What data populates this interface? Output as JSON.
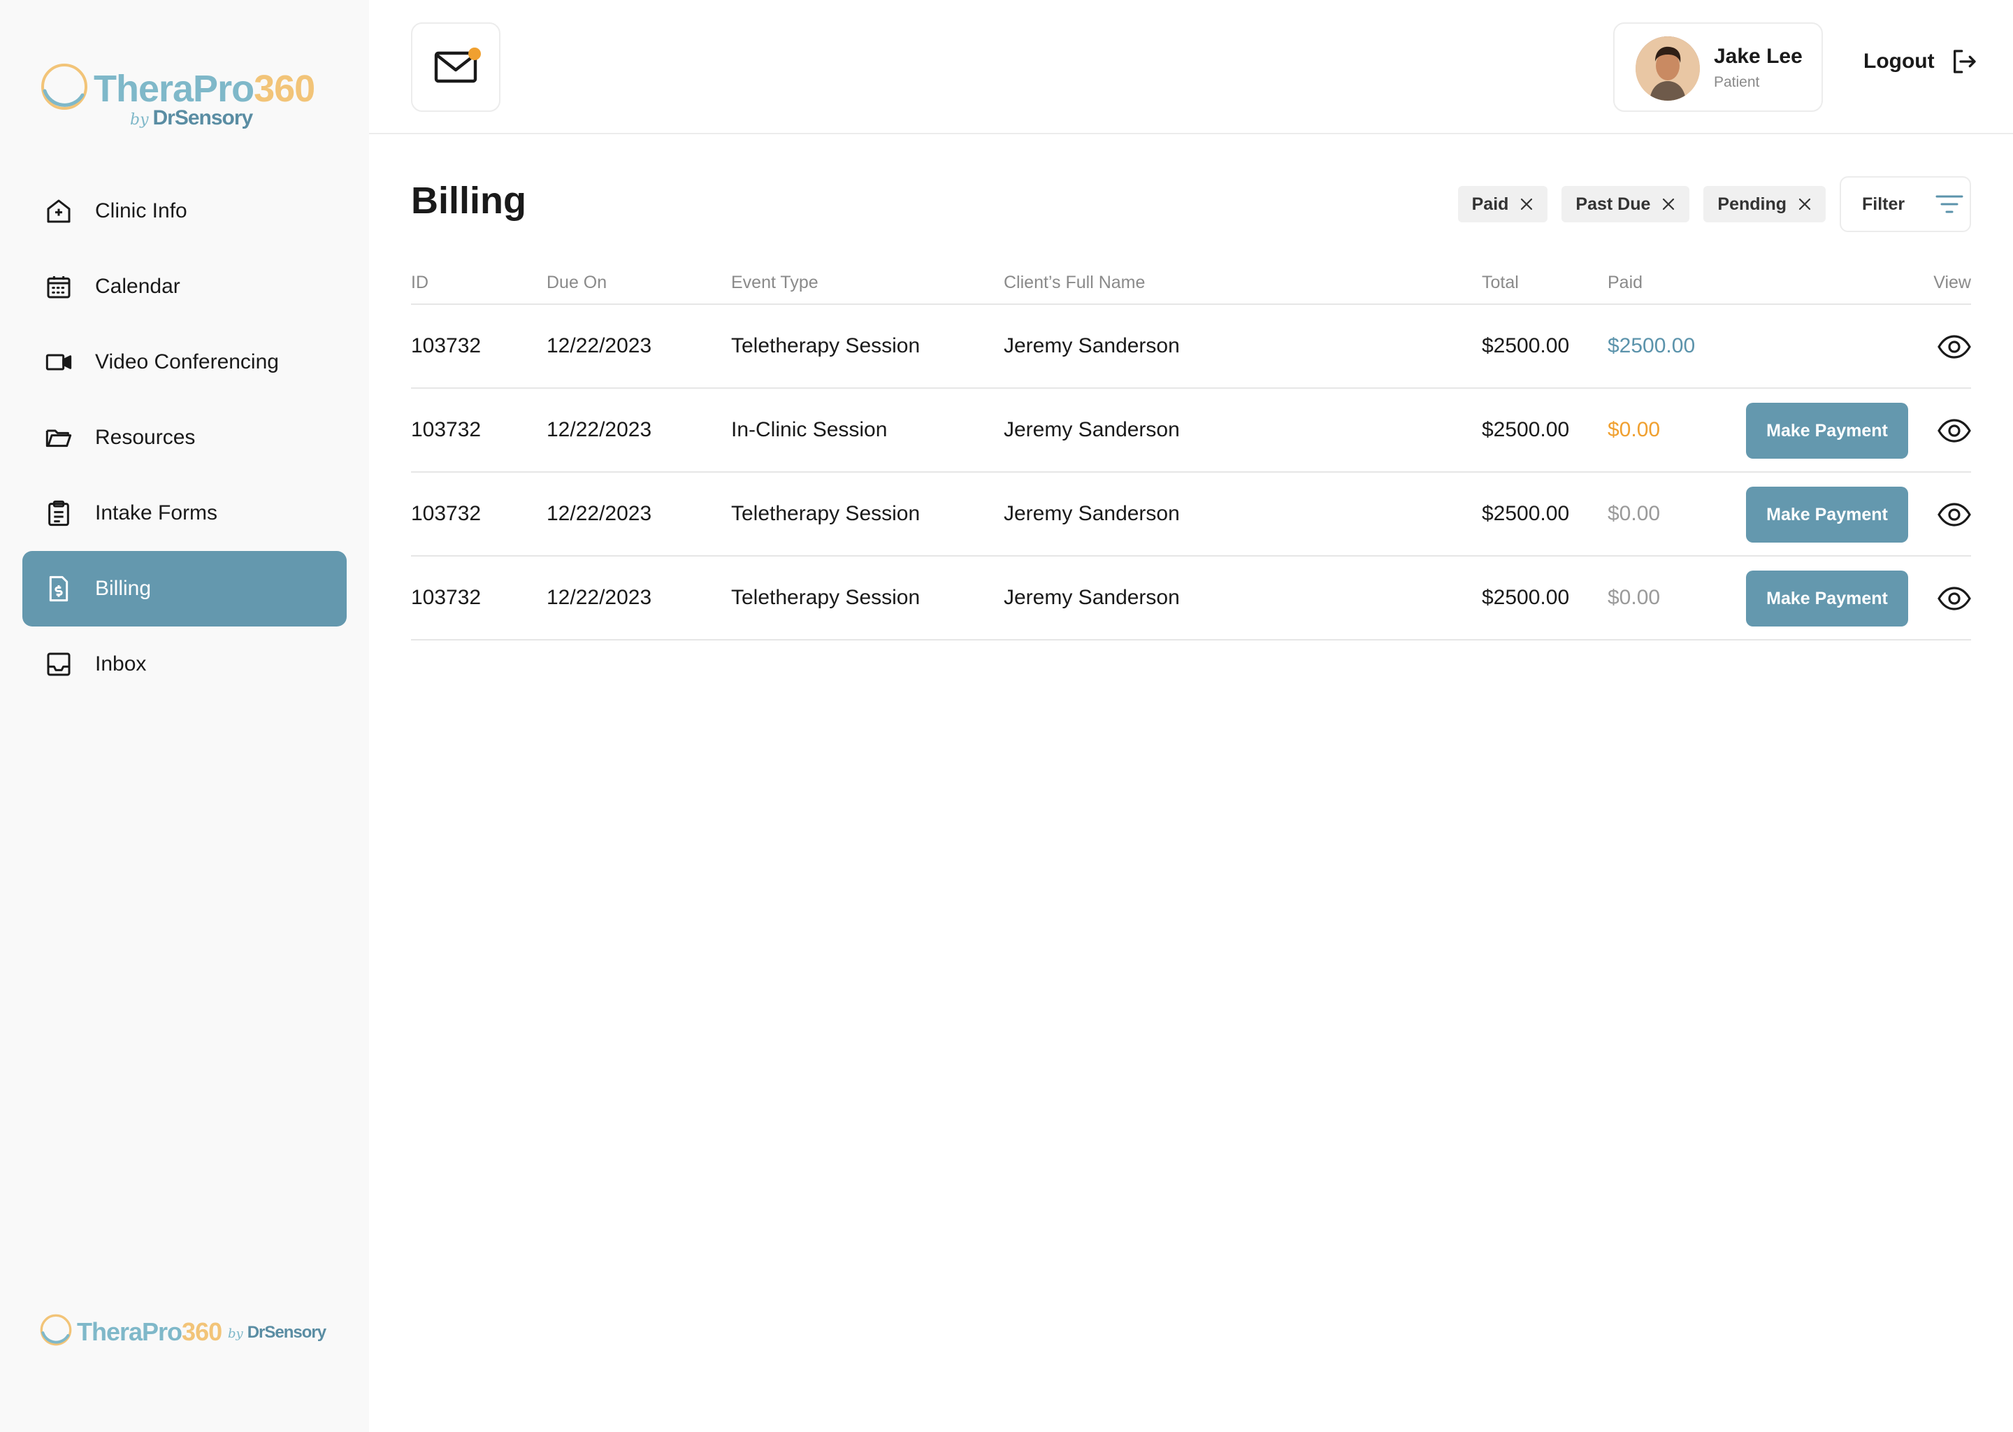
{
  "brand": {
    "name_part1": "TheraPro",
    "name_part2": "360",
    "by": "by",
    "sub": "DrSensory",
    "colors": {
      "teal": "#7fb8c9",
      "gold": "#f2c478",
      "accent": "#6498ae"
    }
  },
  "sidebar": {
    "items": [
      {
        "label": "Clinic Info",
        "icon": "clinic-icon",
        "active": false
      },
      {
        "label": "Calendar",
        "icon": "calendar-icon",
        "active": false
      },
      {
        "label": "Video Conferencing",
        "icon": "video-icon",
        "active": false
      },
      {
        "label": "Resources",
        "icon": "folder-icon",
        "active": false
      },
      {
        "label": "Intake Forms",
        "icon": "clipboard-icon",
        "active": false
      },
      {
        "label": "Billing",
        "icon": "invoice-icon",
        "active": true
      },
      {
        "label": "Inbox",
        "icon": "inbox-icon",
        "active": false
      }
    ]
  },
  "header": {
    "mail_icon": "mail-icon",
    "has_unread": true,
    "user": {
      "name": "Jake Lee",
      "role": "Patient"
    },
    "logout_label": "Logout"
  },
  "page": {
    "title": "Billing",
    "chips": [
      {
        "label": "Paid"
      },
      {
        "label": "Past Due"
      },
      {
        "label": "Pending"
      }
    ],
    "filter_label": "Filter"
  },
  "table": {
    "columns": [
      "ID",
      "Due On",
      "Event Type",
      "Client’s Full Name",
      "Total",
      "Paid",
      "View"
    ],
    "rows": [
      {
        "id": "103732",
        "due_on": "12/22/2023",
        "event_type": "Teletherapy Session",
        "client": "Jeremy Sanderson",
        "total": "$2500.00",
        "paid": "$2500.00",
        "paid_status": "paid",
        "action": ""
      },
      {
        "id": "103732",
        "due_on": "12/22/2023",
        "event_type": "In-Clinic Session",
        "client": "Jeremy Sanderson",
        "total": "$2500.00",
        "paid": "$0.00",
        "paid_status": "past-due",
        "action": "Make Payment"
      },
      {
        "id": "103732",
        "due_on": "12/22/2023",
        "event_type": "Teletherapy Session",
        "client": "Jeremy Sanderson",
        "total": "$2500.00",
        "paid": "$0.00",
        "paid_status": "pending",
        "action": "Make Payment"
      },
      {
        "id": "103732",
        "due_on": "12/22/2023",
        "event_type": "Teletherapy Session",
        "client": "Jeremy Sanderson",
        "total": "$2500.00",
        "paid": "$0.00",
        "paid_status": "pending",
        "action": "Make Payment"
      }
    ],
    "status_colors": {
      "paid": "#5b93ab",
      "past-due": "#f0a030",
      "pending": "#9a9a9a"
    }
  }
}
